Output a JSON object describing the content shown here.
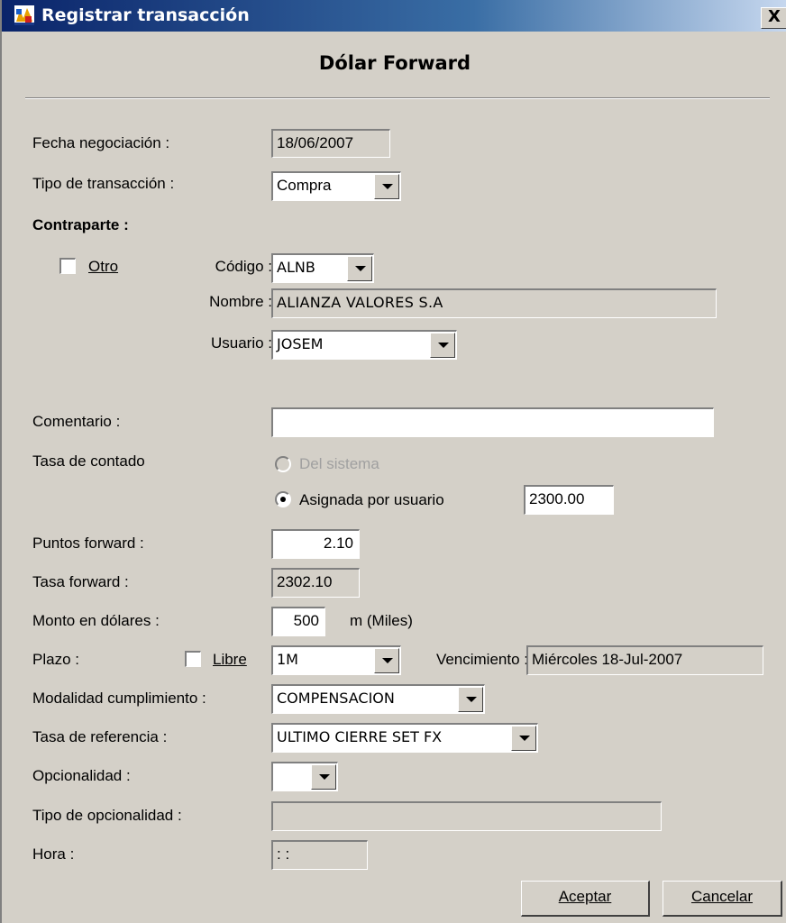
{
  "window": {
    "title": "Registrar transacción",
    "close": "X"
  },
  "form": {
    "heading": "Dólar Forward",
    "fecha_label": "Fecha negociación :",
    "fecha_value": "18/06/2007",
    "tipo_label": "Tipo de transacción :",
    "tipo_value": "Compra",
    "contraparte_label": "Contraparte :",
    "otro_label": "Otro",
    "codigo_label": "Código :",
    "codigo_value": "ALNB",
    "nombre_label": "Nombre :",
    "nombre_value": "ALIANZA VALORES S.A",
    "usuario_label": "Usuario :",
    "usuario_value": "JOSEM",
    "comentario_label": "Comentario :",
    "comentario_value": "",
    "tasa_contado_label": "Tasa de contado",
    "del_sistema_label": "Del sistema",
    "asignada_label": "Asignada por usuario",
    "asignada_value": "2300.00",
    "puntos_label": "Puntos forward :",
    "puntos_value": "2.10",
    "tasa_forward_label": "Tasa forward :",
    "tasa_forward_value": "2302.10",
    "monto_label": "Monto en dólares :",
    "monto_value": "500",
    "monto_unit": "m (Miles)",
    "plazo_label": "Plazo :",
    "libre_label": "Libre",
    "plazo_value": "1M",
    "vencimiento_label": "Vencimiento :",
    "vencimiento_value": "Miércoles 18-Jul-2007",
    "modalidad_label": "Modalidad cumplimiento :",
    "modalidad_value": "COMPENSACION",
    "referencia_label": "Tasa de referencia :",
    "referencia_value": "ULTIMO CIERRE SET FX",
    "opcionalidad_label": "Opcionalidad :",
    "opcionalidad_value": "",
    "tipo_opc_label": "Tipo de opcionalidad :",
    "tipo_opc_value": "",
    "hora_label": "Hora :",
    "hora_value": " : :"
  },
  "buttons": {
    "aceptar": "Aceptar",
    "cancelar": "Cancelar"
  }
}
